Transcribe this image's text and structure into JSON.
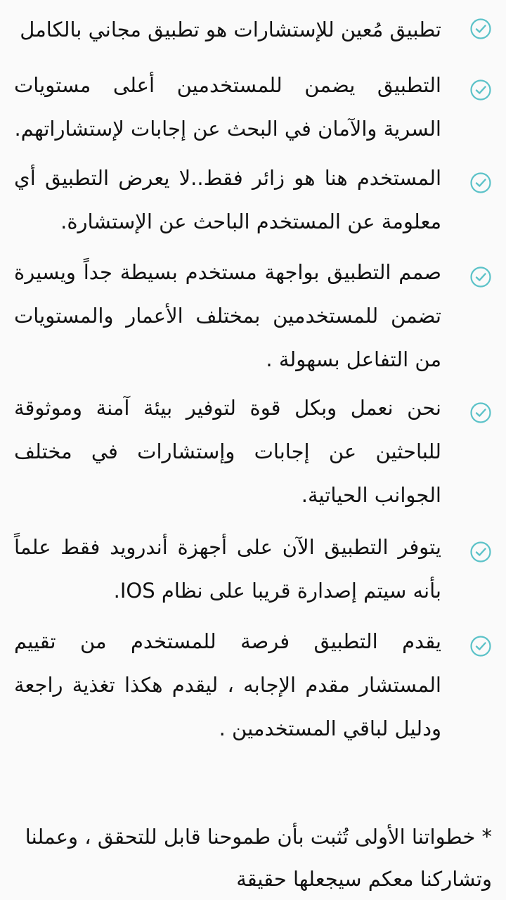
{
  "check_icon": {
    "name": "check-circle-icon",
    "color": "#5bc2c8"
  },
  "features": [
    {
      "text": "تطبيق مُعين للإستشارات هو تطبيق مجاني بالكامل"
    },
    {
      "text": "التطبيق يضمن للمستخدمين أعلى مستويات السرية والآمان في البحث عن إجابات لإستشاراتهم."
    },
    {
      "text": "المستخدم هنا هو زائر فقط..لا يعرض التطبيق أي معلومة عن المستخدم الباحث عن الإستشارة."
    },
    {
      "text": "صمم التطبيق بواجهة مستخدم بسيطة جداً ويسيرة تضمن للمستخدمين بمختلف الأعمار والمستويات من التفاعل بسهولة ."
    },
    {
      "text": "نحن نعمل وبكل قوة لتوفير بيئة آمنة وموثوقة للباحثين عن إجابات وإستشارات في مختلف الجوانب الحياتية."
    },
    {
      "text": "يتوفر التطبيق الآن على أجهزة أندرويد فقط علماً بأنه سيتم إصدارة قريبا على نظام IOS."
    },
    {
      "text": "يقدم التطبيق فرصة للمستخدم من تقييم المستشار مقدم الإجابه ، ليقدم هكذا تغذية راجعة ودليل لباقي المستخدمين ."
    }
  ],
  "footer_note": "* خطواتنا الأولى تُثبت بأن طموحنا قابل للتحقق ، وعملنا وتشاركنا معكم سيجعلها حقيقة"
}
